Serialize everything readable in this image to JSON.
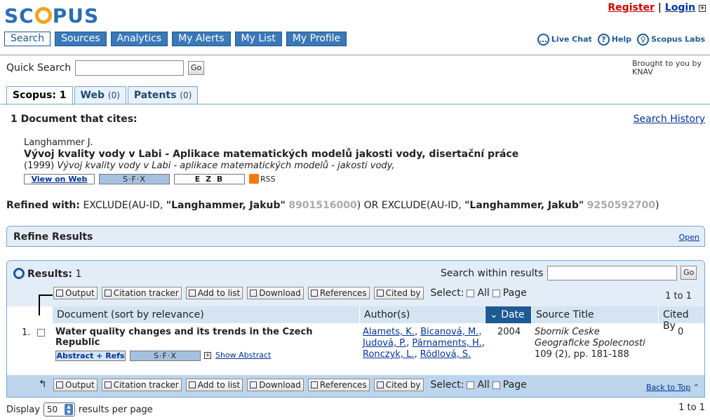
{
  "header": {
    "logo": "SCOPUS",
    "register": "Register",
    "login": "Login",
    "nav": [
      "Search",
      "Sources",
      "Analytics",
      "My Alerts",
      "My List",
      "My Profile"
    ],
    "help": [
      "Live Chat",
      "Help",
      "Scopus Labs"
    ]
  },
  "quick_search": {
    "label": "Quick Search",
    "value": "",
    "go": "Go",
    "brought_by": "Brought to you by KNAV"
  },
  "tabs": [
    {
      "label": "Scopus: 1",
      "count": ""
    },
    {
      "label": "Web",
      "count": "(0)"
    },
    {
      "label": "Patents",
      "count": "(0)"
    }
  ],
  "cites": {
    "heading": "1  Document that cites:",
    "history": "Search History",
    "author": "Langhammer J.",
    "title": "Vývoj kvality vody v Labi - Aplikace matematických modelů jakosti vody, disertační práce",
    "year": "(1999)",
    "source": "Vývoj kvality vody v Labi - aplikace matematických modelů - jakosti vody,",
    "view_web": "View on Web",
    "sfx": "S·F·X",
    "ezb": "E Z B",
    "rss": "RSS"
  },
  "refined": {
    "label": "Refined with:",
    "p1": "EXCLUDE(AU-ID,",
    "name1": "\"Langhammer, Jakub\"",
    "id1": "8901516000",
    "p2": ") OR EXCLUDE(AU-ID,",
    "name2": "\"Langhammer, Jakub\"",
    "id2": "9250592700",
    "p3": ")"
  },
  "refine_panel": {
    "title": "Refine Results",
    "open": "Open"
  },
  "results": {
    "label": "Results:",
    "count": "1",
    "search_within": "Search within results",
    "search_within_value": "",
    "go": "Go",
    "toolbar": [
      "Output",
      "Citation tracker",
      "Add to list",
      "Download",
      "References",
      "Cited by"
    ],
    "select": "Select:",
    "all": "All",
    "page": "Page",
    "range": "1 to 1",
    "columns": {
      "document": "Document (sort by relevance)",
      "authors": "Author(s)",
      "date": "Date",
      "source": "Source Title",
      "cited": "Cited By"
    },
    "rows": [
      {
        "num": "1.",
        "title": "Water quality changes and its trends in the Czech Republic",
        "authors": [
          "Alamets, K.",
          "Bicanová, M.",
          "Judová, P.",
          "Pärnaments, H.",
          "Ronczyk, L.",
          "Rödlová, S."
        ],
        "date": "2004",
        "source_name": "Sbornik Ceske Geograficke Spolecnosti",
        "source_vol": "109 (2), pp. 181-188",
        "cited": "0",
        "abstract_btn": "Abstract + Refs",
        "show_abstract": "Show Abstract"
      }
    ],
    "back_to_top": "Back to Top",
    "display_label": "Display",
    "display_value": "50",
    "per_page": "results per page"
  }
}
